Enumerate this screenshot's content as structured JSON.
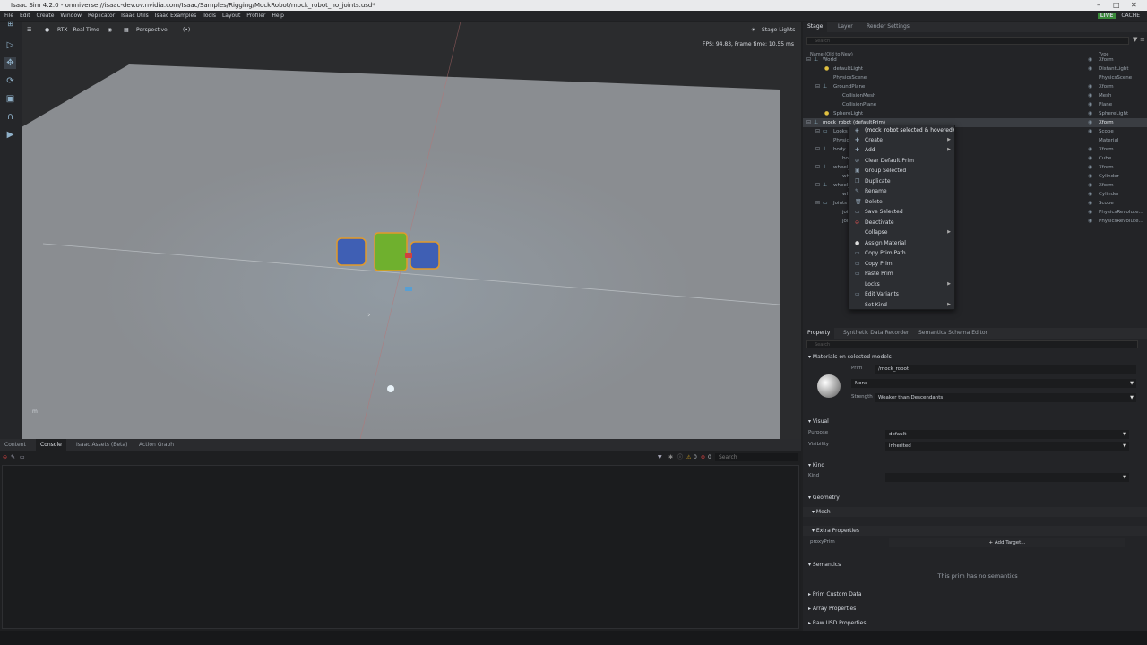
{
  "window": {
    "title": "Isaac Sim 4.2.0 - omniverse://isaac-dev.ov.nvidia.com/Isaac/Samples/Rigging/MockRobot/mock_robot_no_joints.usd*",
    "controls": [
      "–",
      "□",
      "✕"
    ]
  },
  "menubar": {
    "items": [
      "File",
      "Edit",
      "Create",
      "Window",
      "Replicator",
      "Isaac Utils",
      "Isaac Examples",
      "Tools",
      "Layout",
      "Profiler",
      "Help"
    ],
    "live_label": "LIVE",
    "cache_label": "CACHE"
  },
  "viewport": {
    "renderer_label": "RTX - Real-Time",
    "camera_label": "Perspective",
    "stage_lights_label": "Stage Lights",
    "fps_text": "FPS: 94.83, Frame time: 10.55 ms",
    "axis_label": "m"
  },
  "bottom": {
    "tabs": [
      "Content",
      "Console",
      "Isaac Assets (Beta)",
      "Action Graph"
    ],
    "active_tab": "Console",
    "warning_count": "0",
    "error_count": "0",
    "search_placeholder": "Search"
  },
  "stage": {
    "tabs": [
      "Stage",
      "Layer",
      "Render Settings"
    ],
    "search_placeholder": "Search",
    "col_name": "Name (Old to New)",
    "col_type": "Type",
    "rows": [
      {
        "name": "World",
        "type": "Xform"
      },
      {
        "name": "defaultLight",
        "type": "DistantLight"
      },
      {
        "name": "PhysicsScene",
        "type": "PhysicsScene"
      },
      {
        "name": "GroundPlane",
        "type": "Xform"
      },
      {
        "name": "CollisionMesh",
        "type": "Mesh"
      },
      {
        "name": "CollisionPlane",
        "type": "Plane"
      },
      {
        "name": "SphereLight",
        "type": "SphereLight"
      },
      {
        "name": "mock_robot (defaultPrim)",
        "type": "Xform"
      },
      {
        "name": "Looks",
        "type": "Scope"
      },
      {
        "name": "Physic",
        "type": "Material"
      },
      {
        "name": "body",
        "type": "Xform"
      },
      {
        "name": "bo",
        "type": "Cube"
      },
      {
        "name": "wheel_",
        "type": "Xform"
      },
      {
        "name": "wh",
        "type": "Cylinder"
      },
      {
        "name": "wheel_",
        "type": "Xform"
      },
      {
        "name": "wh",
        "type": "Cylinder"
      },
      {
        "name": "Joints",
        "type": "Scope"
      },
      {
        "name": "joi",
        "type": "PhysicsRevolute..."
      },
      {
        "name": "joi",
        "type": "PhysicsRevolute..."
      }
    ]
  },
  "context_menu": {
    "header": "(mock_robot selected & hovered)",
    "items": [
      {
        "label": "Create",
        "sub": true
      },
      {
        "label": "Add",
        "sub": true
      },
      {
        "label": "Clear Default Prim",
        "sub": false
      },
      {
        "label": "Group Selected",
        "sub": false
      },
      {
        "label": "Duplicate",
        "sub": false
      },
      {
        "label": "Rename",
        "sub": false
      },
      {
        "label": "Delete",
        "sub": false
      },
      {
        "label": "Save Selected",
        "sub": false
      },
      {
        "label": "Deactivate",
        "sub": false
      },
      {
        "label": "Collapse",
        "sub": true
      },
      {
        "label": "Assign Material",
        "sub": false
      },
      {
        "label": "Copy Prim Path",
        "sub": false
      },
      {
        "label": "Copy Prim",
        "sub": false
      },
      {
        "label": "Paste Prim",
        "sub": false
      },
      {
        "label": "Locks",
        "sub": true
      },
      {
        "label": "Edit Variants",
        "sub": false
      },
      {
        "label": "Set Kind",
        "sub": true
      }
    ]
  },
  "property": {
    "tabs": [
      "Property",
      "Synthetic Data Recorder",
      "Semantics Schema Editor"
    ],
    "search_placeholder": "Search",
    "materials_header": "Materials on selected models",
    "prim_label": "Prim",
    "prim_value": "/mock_robot",
    "material_value": "None",
    "strength_label": "Strength",
    "strength_value": "Weaker than Descendants",
    "visual_header": "Visual",
    "purpose_label": "Purpose",
    "purpose_value": "default",
    "visibility_label": "Visibility",
    "visibility_value": "inherited",
    "kind_header": "Kind",
    "kind_label": "Kind",
    "kind_value": "",
    "geometry_header": "Geometry",
    "mesh_header": "Mesh",
    "extra_header": "Extra Properties",
    "proxy_label": "proxyPrim",
    "add_target_label": "Add Target...",
    "semantics_header": "Semantics",
    "no_semantics": "This prim has no semantics",
    "custom_data_header": "Prim Custom Data",
    "array_header": "Array Properties",
    "raw_usd_header": "Raw USD Properties"
  }
}
